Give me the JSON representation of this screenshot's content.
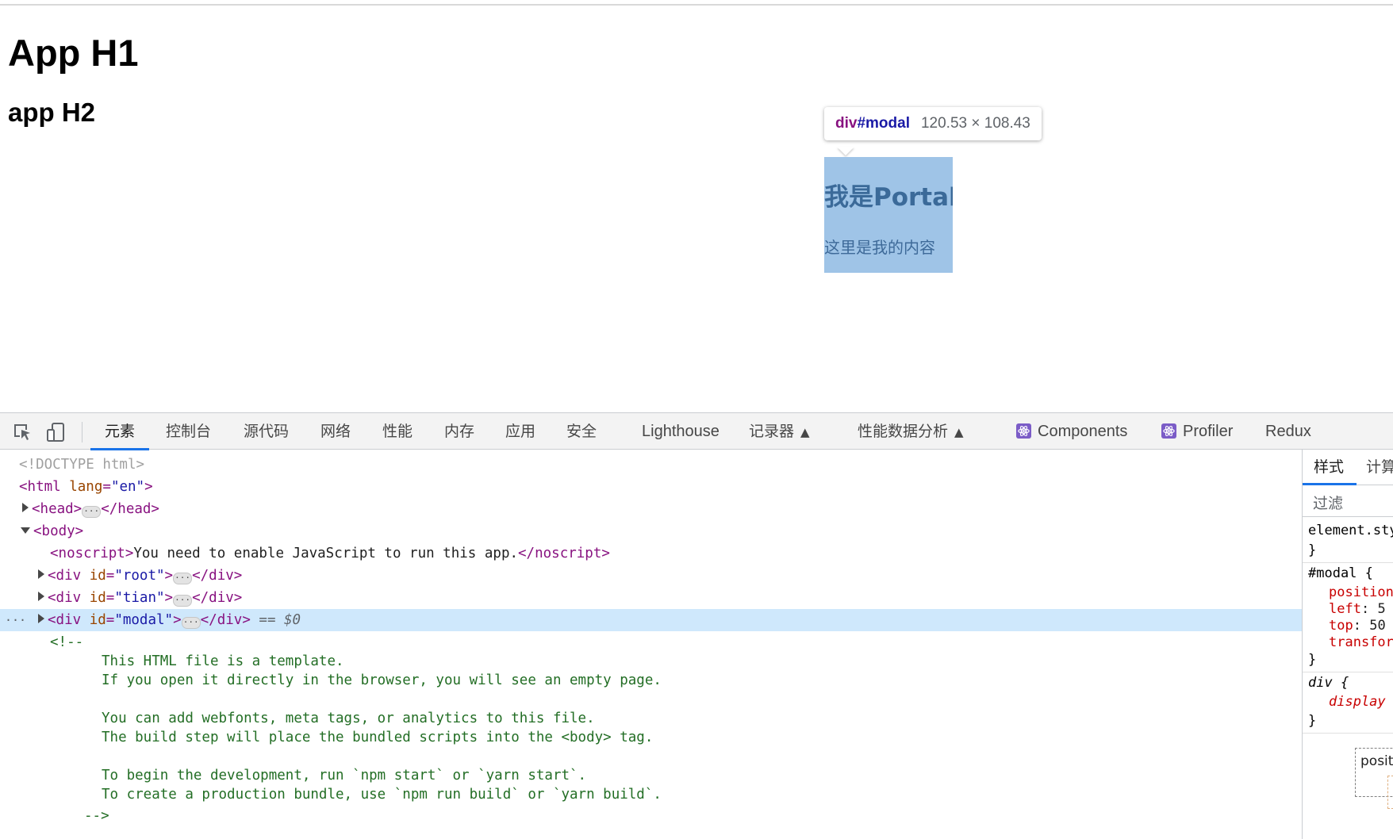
{
  "page": {
    "h1": "App H1",
    "h2": "app H2",
    "modal": {
      "title": "我是Portal",
      "content": "这里是我的内容"
    },
    "tooltip": {
      "selector_tag": "div",
      "selector_id": "#modal",
      "dimensions": "120.53 × 108.43"
    }
  },
  "devtools": {
    "toolbar_icons": [
      "inspect-element-icon",
      "device-toolbar-icon"
    ],
    "tabs": [
      "元素",
      "控制台",
      "源代码",
      "网络",
      "性能",
      "内存",
      "应用",
      "安全",
      "Lighthouse",
      "记录器",
      "性能数据分析",
      "Components",
      "Profiler",
      "Redux"
    ],
    "active_tab": "元素",
    "experimental_icon": "flask-icon",
    "react_icon": "react-atom-icon",
    "tree": {
      "doctype": "<!DOCTYPE html>",
      "html_open": "<html",
      "html_attr": "lang",
      "html_val": "\"en\"",
      "head_open": "<head>",
      "head_close": "</head>",
      "body_open": "<body>",
      "noscript_open": "<noscript>",
      "noscript_text": "You need to enable JavaScript to run this app.",
      "noscript_close": "</noscript>",
      "div_open": "<div",
      "div_close": "</div>",
      "id_attr": "id",
      "root_val": "\"root\"",
      "tian_val": "\"tian\"",
      "modal_val": "\"modal\"",
      "selected_marker": "== $0",
      "gutter_dots": "···",
      "comment_open": "<!--",
      "comment_lines": [
        "This HTML file is a template.",
        "If you open it directly in the browser, you will see an empty page.",
        "",
        "You can add webfonts, meta tags, or analytics to this file.",
        "The build step will place the bundled scripts into the <body> tag.",
        "",
        "To begin the development, run `npm start` or `yarn start`.",
        "To create a production bundle, use `npm run build` or `yarn build`."
      ],
      "comment_close": "-->"
    },
    "styles_panel": {
      "tabs": [
        "样式",
        "计算"
      ],
      "filter_placeholder": "过滤",
      "element_style": "element.style {",
      "close_brace": "}",
      "modal_selector": "#modal {",
      "modal_props": [
        {
          "name": "position",
          "value": ""
        },
        {
          "name": "left",
          "value": "5"
        },
        {
          "name": "top",
          "value": "50"
        },
        {
          "name": "transform",
          "value": ""
        }
      ],
      "div_selector": "div {",
      "div_prop": "display",
      "boxmodel_label": "position"
    }
  }
}
